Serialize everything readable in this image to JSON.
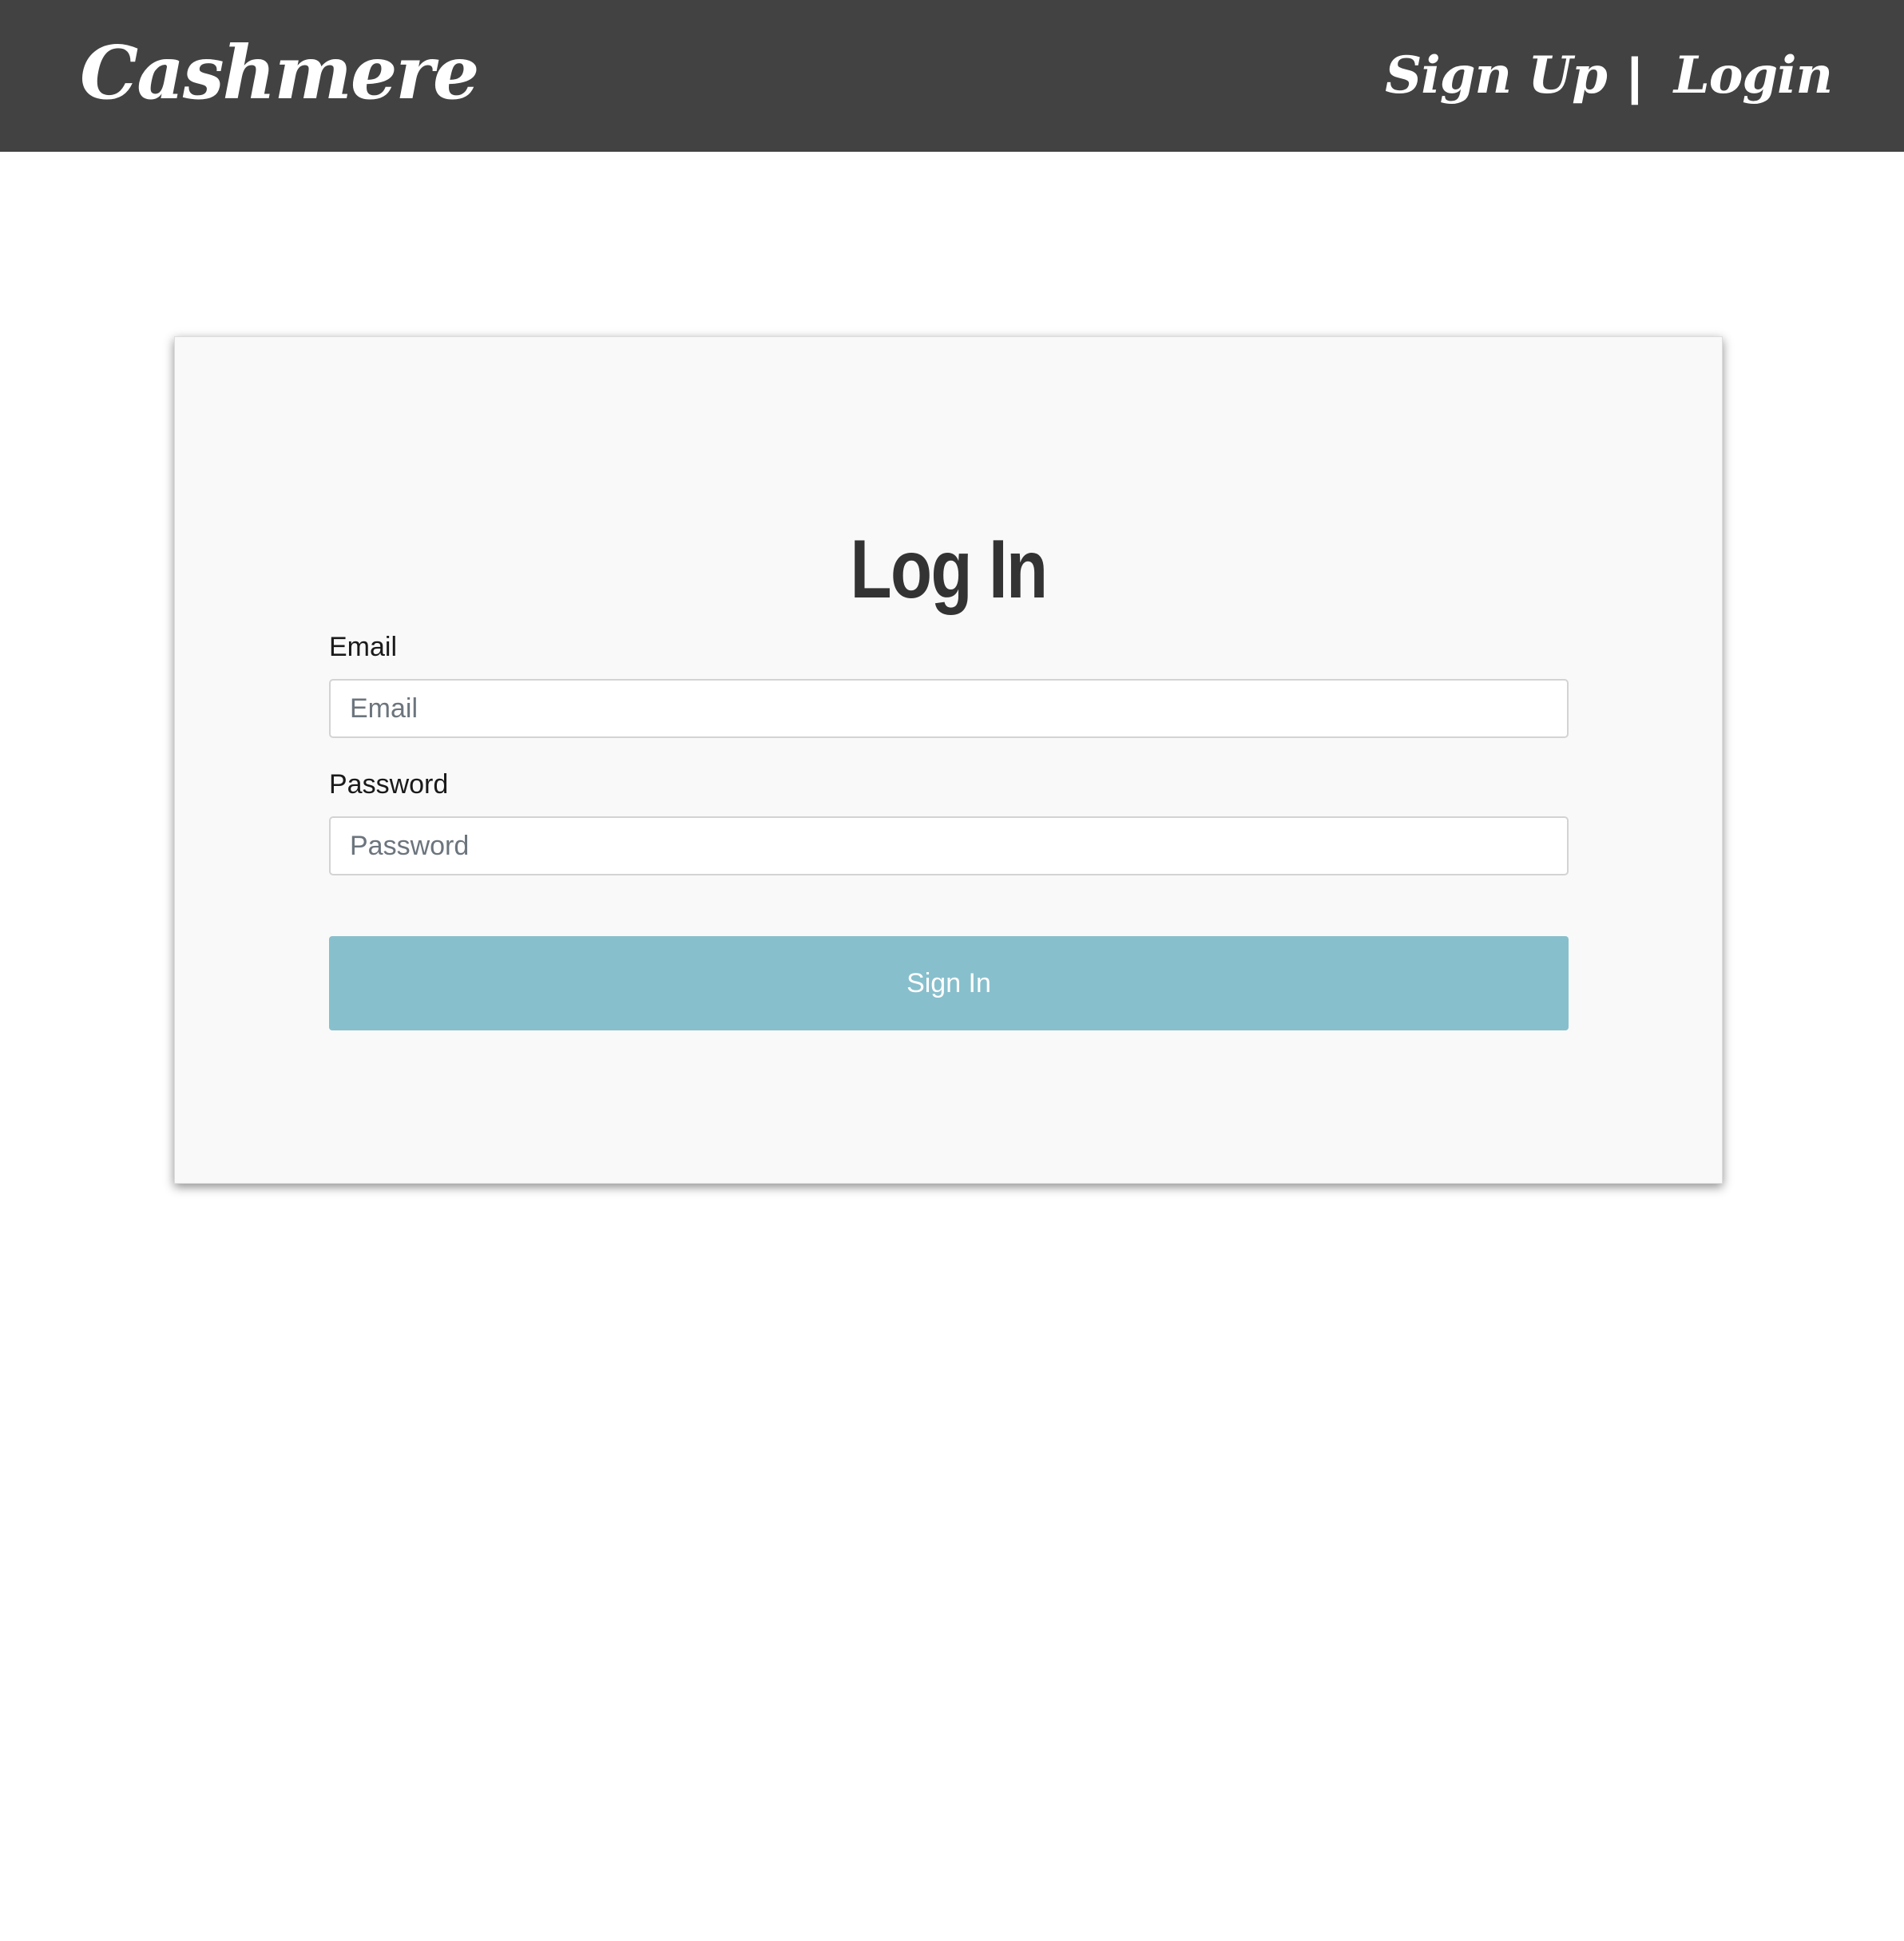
{
  "header": {
    "brand": "Cashmere",
    "nav": {
      "signup_label": "Sign Up",
      "separator": "|",
      "login_label": "Login"
    }
  },
  "login_form": {
    "title": "Log In",
    "email": {
      "label": "Email",
      "placeholder": "Email",
      "value": ""
    },
    "password": {
      "label": "Password",
      "placeholder": "Password",
      "value": ""
    },
    "submit_label": "Sign In"
  },
  "colors": {
    "navbar_bg": "#424242",
    "card_bg": "#f9f9f9",
    "button_bg": "#88bfcc",
    "title_text": "#333333"
  }
}
